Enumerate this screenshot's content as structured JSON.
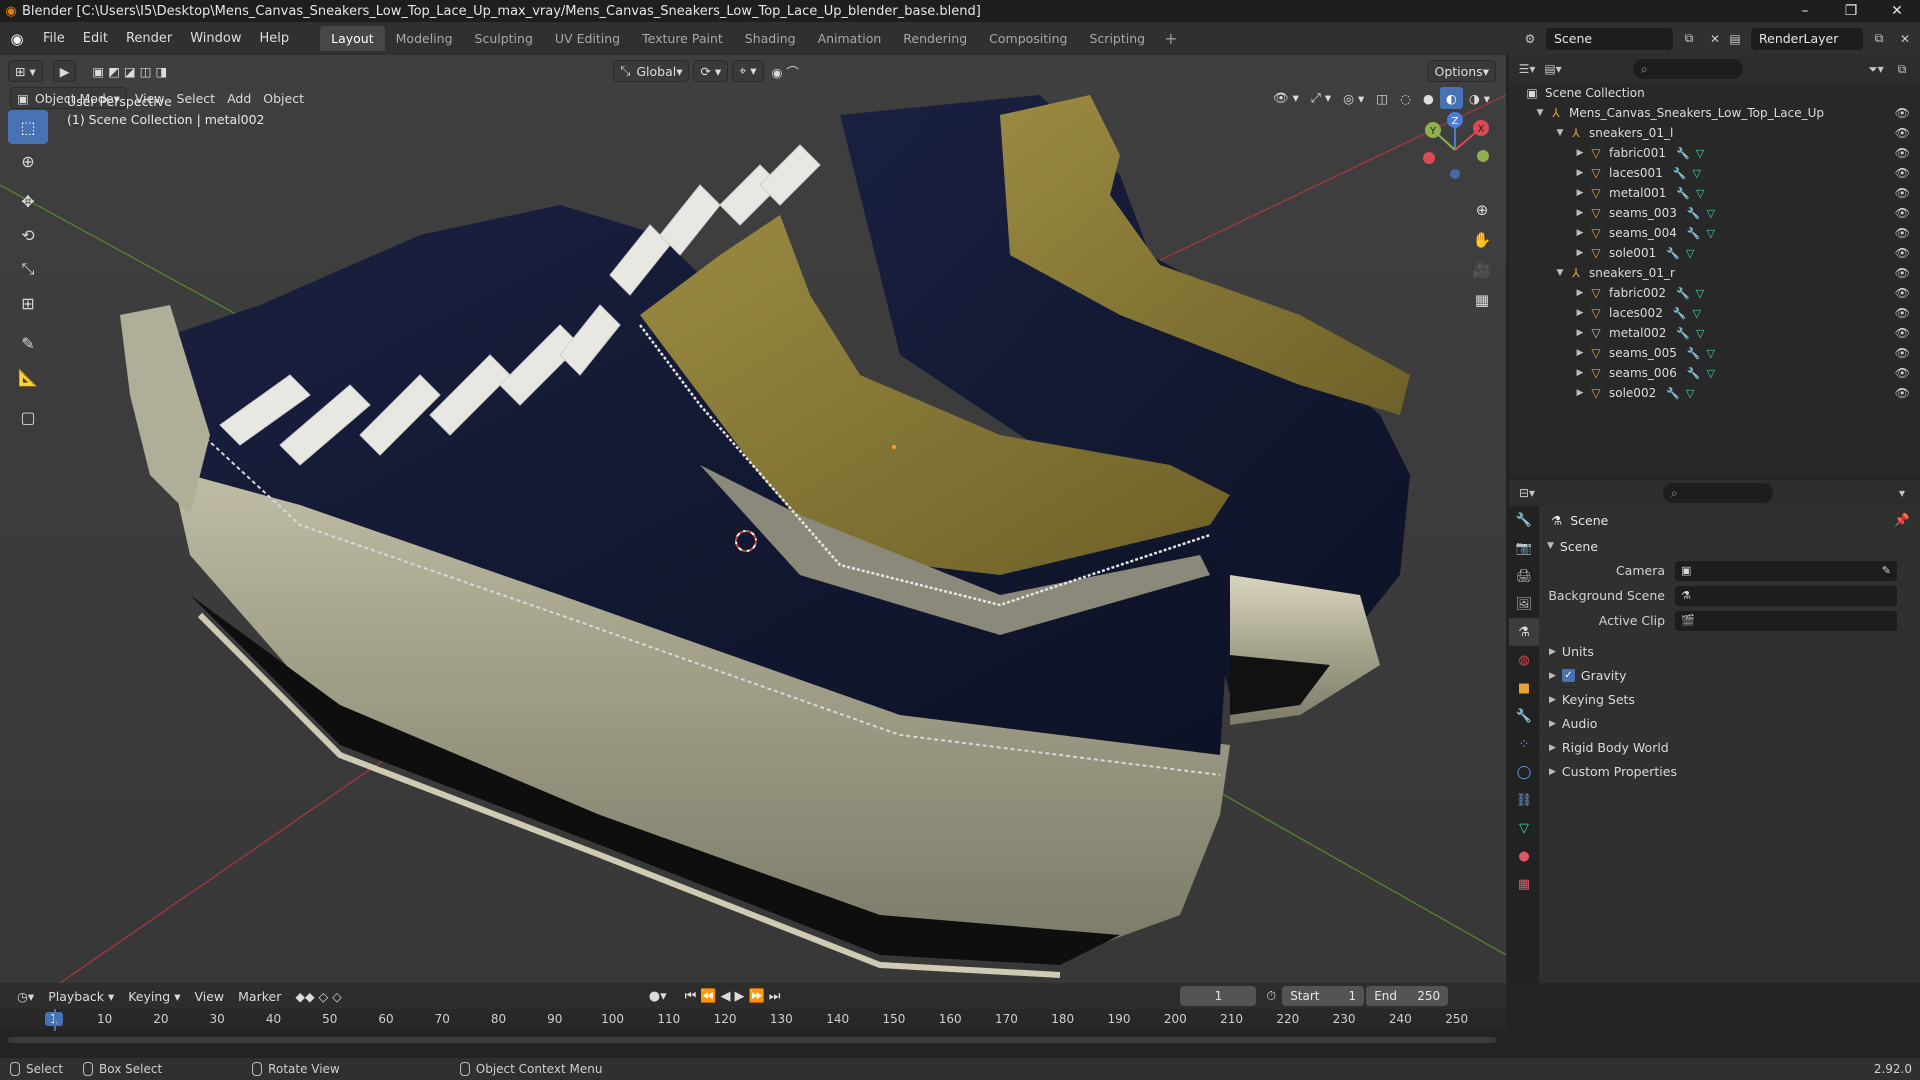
{
  "window": {
    "title": "Blender [C:\\Users\\I5\\Desktop\\Mens_Canvas_Sneakers_Low_Top_Lace_Up_max_vray/Mens_Canvas_Sneakers_Low_Top_Lace_Up_blender_base.blend]",
    "controls": [
      "minimize-icon",
      "maximize-icon",
      "close-icon"
    ]
  },
  "menubar": {
    "menus": [
      "File",
      "Edit",
      "Render",
      "Window",
      "Help"
    ],
    "workspaces": [
      "Layout",
      "Modeling",
      "Sculpting",
      "UV Editing",
      "Texture Paint",
      "Shading",
      "Animation",
      "Rendering",
      "Compositing",
      "Scripting"
    ],
    "active_workspace": "Layout",
    "scene": "Scene",
    "view_layer": "RenderLayer"
  },
  "viewport": {
    "mode": "Object Mode",
    "menus": [
      "View",
      "Select",
      "Add",
      "Object"
    ],
    "orientation": "Global",
    "options_label": "Options",
    "perspective_label": "User Perspective",
    "collection_label": "(1) Scene Collection | metal002",
    "tools": [
      "select-box-icon",
      "cursor-icon",
      "move-icon",
      "rotate-icon",
      "scale-icon",
      "transform-icon",
      "annotate-icon",
      "measure-icon",
      "add-cube-icon"
    ],
    "gizmo_axes": {
      "x": "X",
      "y": "Y",
      "z": "Z"
    }
  },
  "outliner": {
    "root": "Scene Collection",
    "collection": "Mens_Canvas_Sneakers_Low_Top_Lace_Up",
    "groups": [
      {
        "name": "sneakers_01_l",
        "children": [
          "fabric001",
          "laces001",
          "metal001",
          "seams_003",
          "seams_004",
          "sole001"
        ]
      },
      {
        "name": "sneakers_01_r",
        "children": [
          "fabric002",
          "laces002",
          "metal002",
          "seams_005",
          "seams_006",
          "sole002"
        ]
      }
    ],
    "selected": "metal002"
  },
  "properties": {
    "title": "Scene",
    "section": "Scene",
    "fields": [
      {
        "label": "Camera",
        "value": ""
      },
      {
        "label": "Background Scene",
        "value": ""
      },
      {
        "label": "Active Clip",
        "value": ""
      }
    ],
    "panels": [
      "Units",
      "Gravity",
      "Keying Sets",
      "Audio",
      "Rigid Body World",
      "Custom Properties"
    ],
    "gravity_checked": true
  },
  "timeline": {
    "menus": [
      "Playback",
      "Keying",
      "View",
      "Marker"
    ],
    "current_frame": "1",
    "start_label": "Start",
    "start": "1",
    "end_label": "End",
    "end": "250",
    "ticks": [
      "1",
      "10",
      "20",
      "30",
      "40",
      "50",
      "60",
      "70",
      "80",
      "90",
      "100",
      "110",
      "120",
      "130",
      "140",
      "150",
      "160",
      "170",
      "180",
      "190",
      "200",
      "210",
      "220",
      "230",
      "240",
      "250"
    ]
  },
  "statusbar": {
    "items": [
      "Select",
      "Box Select",
      "Rotate View",
      "Object Context Menu"
    ],
    "version": "2.92.0"
  },
  "colors": {
    "accent": "#4772b3",
    "viewport_bg": "#3d3d3d",
    "panel_bg": "#303030",
    "sneaker_canvas": "#141a33",
    "sneaker_lining": "#8a7a35",
    "sole": "#c2bea6"
  }
}
